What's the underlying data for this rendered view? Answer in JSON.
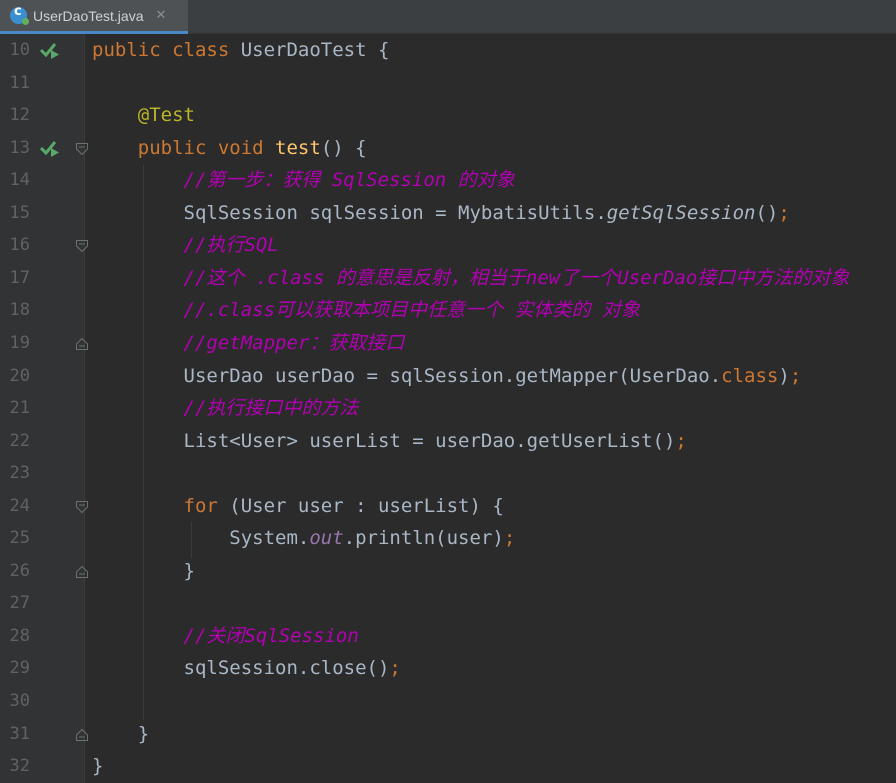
{
  "tab": {
    "filename": "UserDaoTest.java",
    "close_glyph": "✕"
  },
  "lines": [
    {
      "num": "10",
      "parts": [
        [
          "kw",
          "public "
        ],
        [
          "kw",
          "class "
        ],
        [
          "plain",
          "UserDaoTest {"
        ]
      ]
    },
    {
      "num": "11",
      "parts": []
    },
    {
      "num": "12",
      "parts": [
        [
          "plain",
          "    "
        ],
        [
          "ann",
          "@Test"
        ]
      ]
    },
    {
      "num": "13",
      "parts": [
        [
          "plain",
          "    "
        ],
        [
          "kw",
          "public "
        ],
        [
          "kw",
          "void "
        ],
        [
          "fn",
          "test"
        ],
        [
          "plain",
          "() {"
        ]
      ]
    },
    {
      "num": "14",
      "parts": [
        [
          "plain",
          "        "
        ],
        [
          "cm",
          "//第一步：获得 SqlSession 的对象"
        ]
      ]
    },
    {
      "num": "15",
      "parts": [
        [
          "plain",
          "        SqlSession sqlSession = MybatisUtils."
        ],
        [
          "st",
          "getSqlSession"
        ],
        [
          "plain",
          "()"
        ],
        [
          "kw",
          ";"
        ]
      ]
    },
    {
      "num": "16",
      "parts": [
        [
          "plain",
          "        "
        ],
        [
          "cm",
          "//执行SQL"
        ]
      ]
    },
    {
      "num": "17",
      "parts": [
        [
          "plain",
          "        "
        ],
        [
          "cm",
          "//这个 .class 的意思是反射，相当于new了一个UserDao接口中方法的对象"
        ]
      ]
    },
    {
      "num": "18",
      "parts": [
        [
          "plain",
          "        "
        ],
        [
          "cm",
          "//.class可以获取本项目中任意一个 实体类的 对象"
        ]
      ]
    },
    {
      "num": "19",
      "parts": [
        [
          "plain",
          "        "
        ],
        [
          "cm",
          "//getMapper：获取接口"
        ]
      ]
    },
    {
      "num": "20",
      "parts": [
        [
          "plain",
          "        UserDao userDao = sqlSession.getMapper(UserDao."
        ],
        [
          "kw",
          "class"
        ],
        [
          "plain",
          ")"
        ],
        [
          "kw",
          ";"
        ]
      ]
    },
    {
      "num": "21",
      "parts": [
        [
          "plain",
          "        "
        ],
        [
          "cm",
          "//执行接口中的方法"
        ]
      ]
    },
    {
      "num": "22",
      "parts": [
        [
          "plain",
          "        List<User> userList = userDao.getUserList()"
        ],
        [
          "kw",
          ";"
        ]
      ]
    },
    {
      "num": "23",
      "parts": []
    },
    {
      "num": "24",
      "parts": [
        [
          "plain",
          "        "
        ],
        [
          "kw",
          "for "
        ],
        [
          "plain",
          "(User user : userList) {"
        ]
      ]
    },
    {
      "num": "25",
      "parts": [
        [
          "plain",
          "            System."
        ],
        [
          "fld",
          "out"
        ],
        [
          "plain",
          ".println(user)"
        ],
        [
          "kw",
          ";"
        ]
      ]
    },
    {
      "num": "26",
      "parts": [
        [
          "plain",
          "        }"
        ]
      ]
    },
    {
      "num": "27",
      "parts": []
    },
    {
      "num": "28",
      "parts": [
        [
          "plain",
          "        "
        ],
        [
          "cm",
          "//关闭SqlSession"
        ]
      ]
    },
    {
      "num": "29",
      "parts": [
        [
          "plain",
          "        sqlSession.close()"
        ],
        [
          "kw",
          ";"
        ]
      ]
    },
    {
      "num": "30",
      "parts": []
    },
    {
      "num": "31",
      "parts": [
        [
          "plain",
          "    }"
        ]
      ]
    },
    {
      "num": "32",
      "parts": [
        [
          "plain",
          "}"
        ]
      ]
    }
  ],
  "gutter_markers": {
    "run": [
      "10",
      "13"
    ],
    "fold_open": [
      "13",
      "16",
      "24"
    ],
    "fold_close": [
      "19",
      "26",
      "31"
    ]
  },
  "colors": {
    "background": "#2b2b2b",
    "keyword": "#cc7832",
    "annotation": "#bbb529",
    "method": "#ffc66d",
    "comment": "#b200b2",
    "text": "#a9b7c6",
    "run_icon": "#59a869"
  }
}
